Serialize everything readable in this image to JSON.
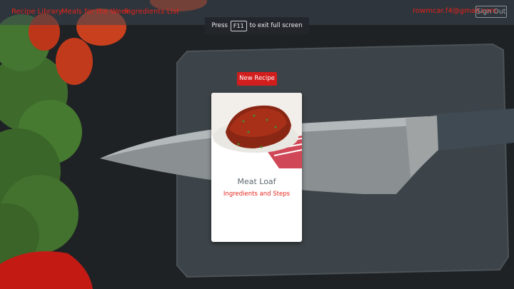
{
  "nav": {
    "links": [
      "Recipe Library",
      "Meals for the Week",
      "Ingredients List"
    ],
    "user_email": "rowmcar.f4@gmail.com",
    "sign_out_label": "Sign Out"
  },
  "fullscreen_notice": {
    "prefix": "Press",
    "key": "F11",
    "suffix": "to exit full screen"
  },
  "new_recipe_label": "New Recipe",
  "recipes": [
    {
      "title": "Meat Loaf",
      "link_label": "Ingredients and Steps"
    }
  ],
  "colors": {
    "accent": "#e5231c",
    "button_red": "#d21d1d",
    "navbar": "#3a4650"
  }
}
